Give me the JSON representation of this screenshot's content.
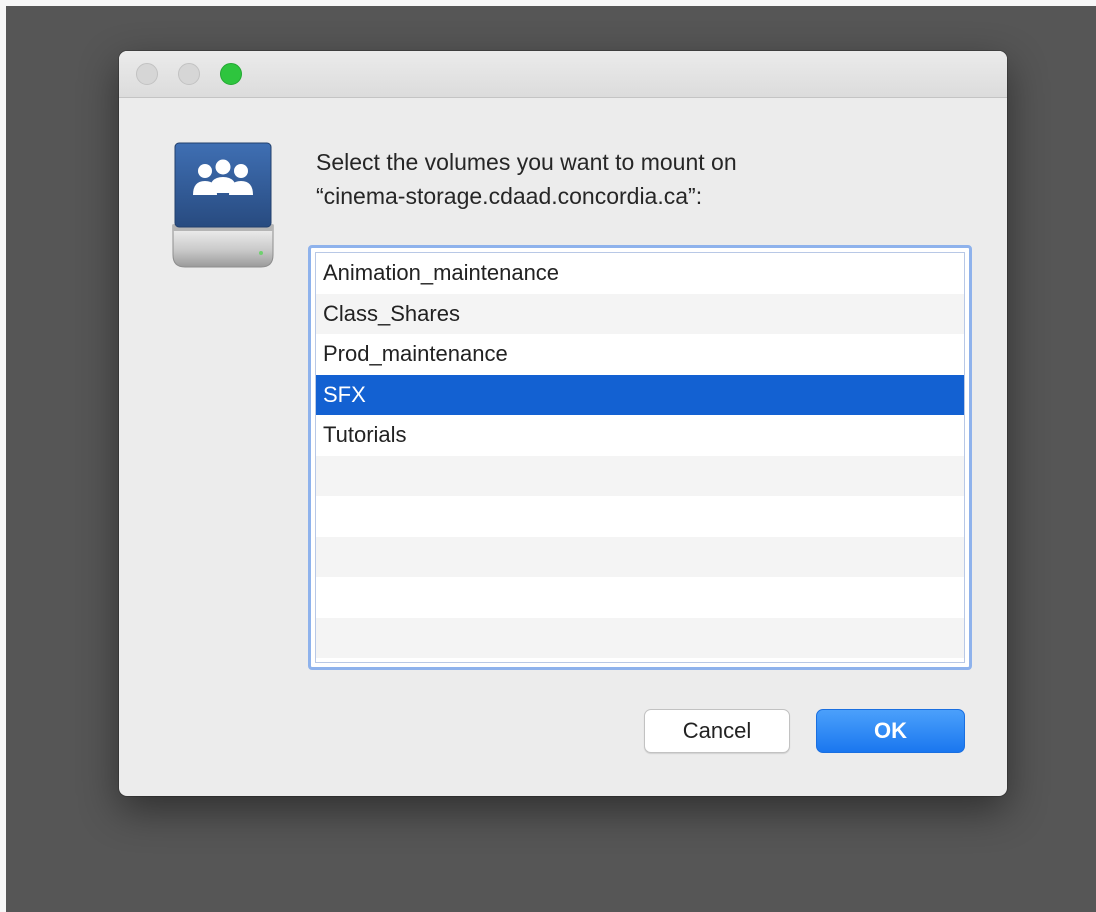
{
  "dialog": {
    "prompt_line1": "Select the volumes you want to mount on",
    "prompt_line2": "“cinema-storage.cdaad.concordia.ca”:",
    "icon": "network-shared-volume-icon",
    "volumes": [
      {
        "label": "Animation_maintenance",
        "selected": false
      },
      {
        "label": "Class_Shares",
        "selected": false
      },
      {
        "label": "Prod_maintenance",
        "selected": false
      },
      {
        "label": "SFX",
        "selected": true
      },
      {
        "label": "Tutorials",
        "selected": false
      }
    ],
    "cancel_label": "Cancel",
    "ok_label": "OK"
  },
  "window_controls": {
    "close_icon": "close-icon",
    "minimize_icon": "minimize-icon",
    "zoom_icon": "zoom-icon"
  },
  "colors": {
    "selection": "#1361d2",
    "accent_button": "#1a77ef",
    "zoom_button": "#2ec53e",
    "focus_ring": "#8eb2ec"
  }
}
